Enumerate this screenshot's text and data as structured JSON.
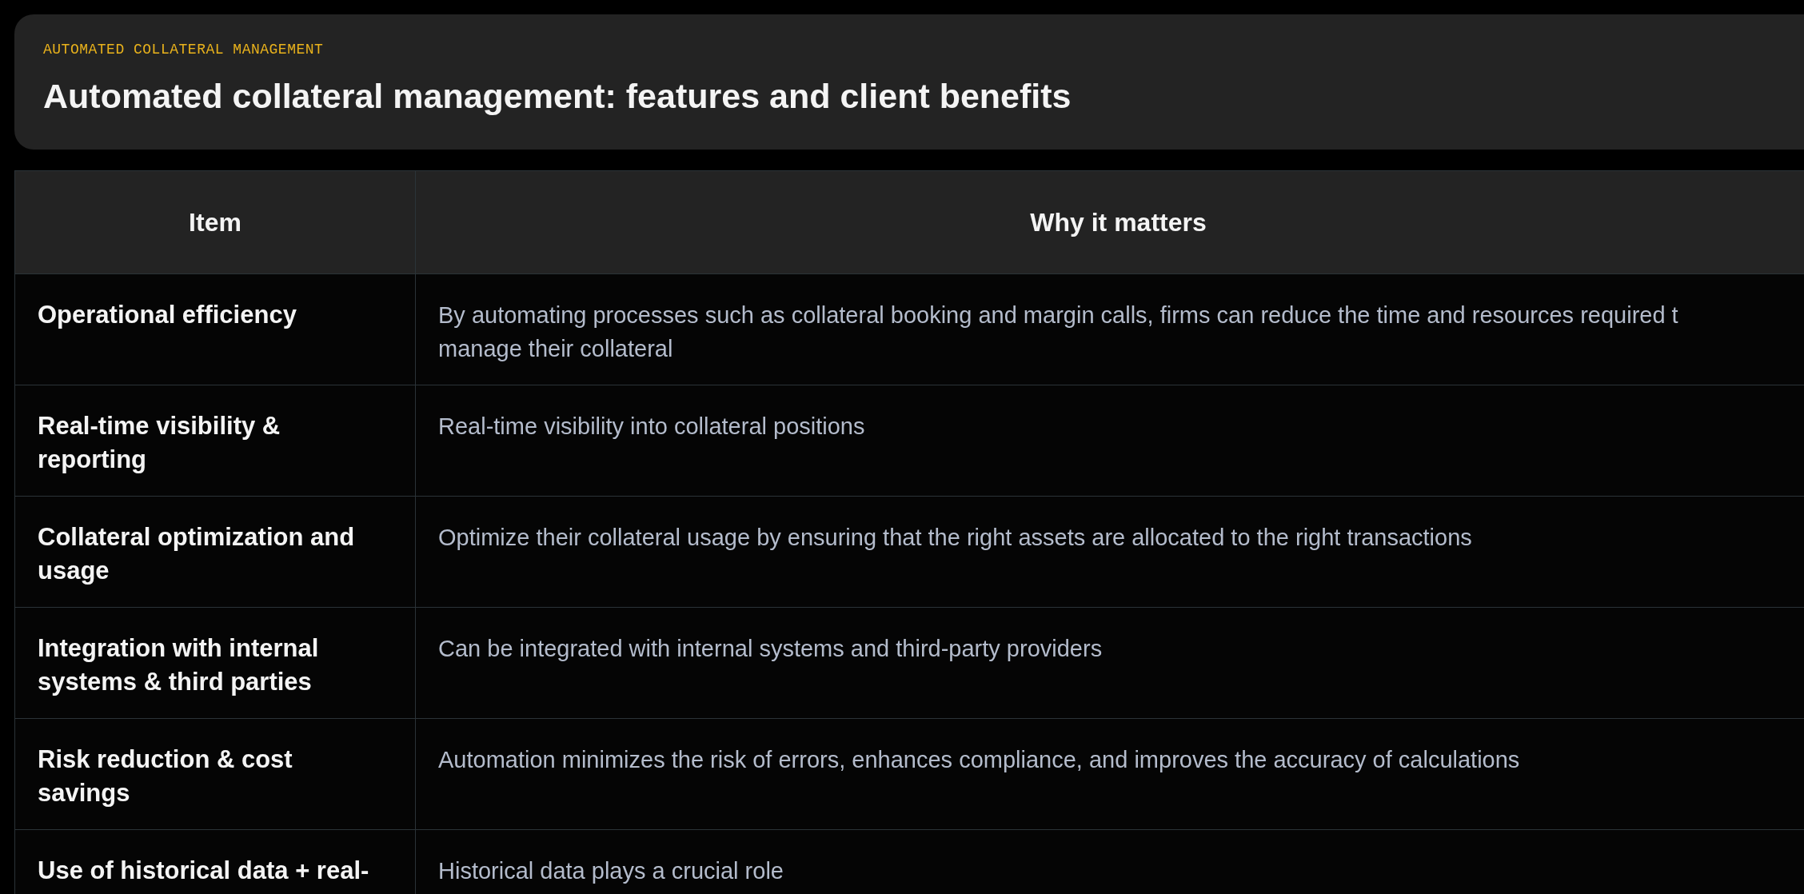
{
  "header": {
    "eyebrow": "AUTOMATED COLLATERAL MANAGEMENT",
    "title": "Automated collateral management: features and client benefits"
  },
  "table": {
    "columns": [
      "Item",
      "Why it matters"
    ],
    "rows": [
      {
        "item": "Operational efficiency",
        "why": [
          "By automating processes such as collateral booking and margin calls, firms can reduce the time and resources required t",
          "manage their collateral"
        ]
      },
      {
        "item": "Real-time visibility & reporting",
        "why": [
          "Real-time visibility into collateral positions"
        ]
      },
      {
        "item": "Collateral optimization and usage",
        "why": [
          "Optimize their collateral usage by ensuring that the right assets are allocated to the right transactions"
        ]
      },
      {
        "item": "Integration with internal systems & third parties",
        "why": [
          "Can be integrated with internal systems and third-party providers"
        ]
      },
      {
        "item": "Risk reduction & cost savings",
        "why": [
          "Automation minimizes the risk of errors, enhances compliance, and improves the accuracy of calculations"
        ]
      },
      {
        "item": "Use of historical data + real-",
        "why": [
          "Historical data plays a crucial role"
        ]
      }
    ]
  }
}
